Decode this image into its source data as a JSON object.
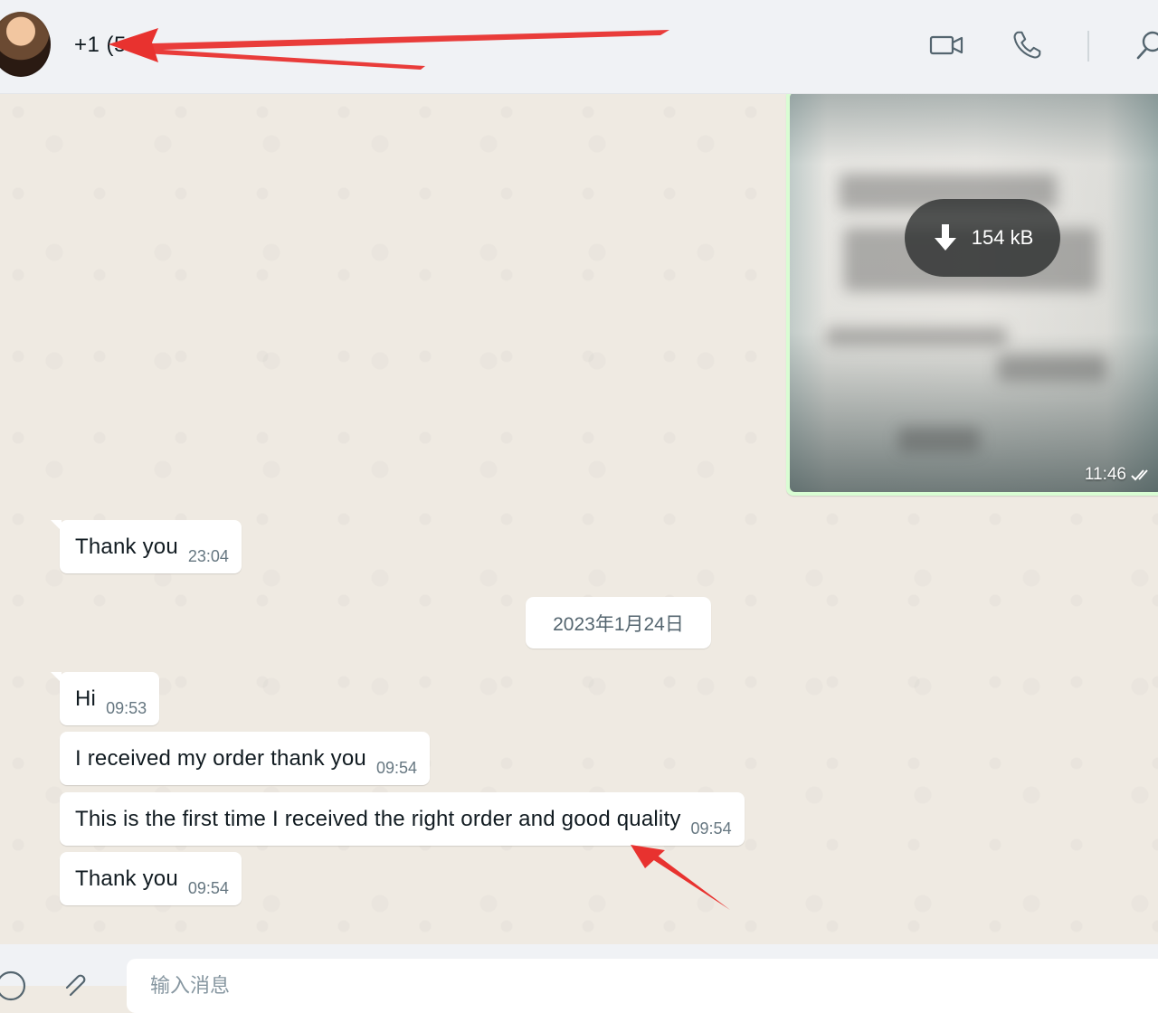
{
  "header": {
    "contact_name": "+1 (5",
    "icons": [
      "video-camera-icon",
      "phone-icon",
      "search-icon"
    ]
  },
  "chat": {
    "image_message": {
      "size_label": "154 kB",
      "time": "11:46",
      "status_icon": "double-check-icon"
    },
    "messages_before": [
      {
        "text": "Thank you",
        "time": "23:04"
      }
    ],
    "date_separator": "2023年1月24日",
    "messages_after": [
      {
        "text": "Hi",
        "time": "09:53"
      },
      {
        "text": "I received my order thank you",
        "time": "09:54"
      },
      {
        "text": "This is the first time I received the right order and good quality",
        "time": "09:54"
      },
      {
        "text": "Thank you",
        "time": "09:54"
      }
    ]
  },
  "composer": {
    "placeholder": "输入消息",
    "icons": [
      "emoji-icon",
      "paperclip-icon"
    ]
  },
  "colors": {
    "chat_background": "#efeae2",
    "outgoing_bubble": "#d9fdd3",
    "incoming_bubble": "#ffffff",
    "header_background": "#f0f2f5",
    "annotation_arrow": "#e8322f"
  }
}
